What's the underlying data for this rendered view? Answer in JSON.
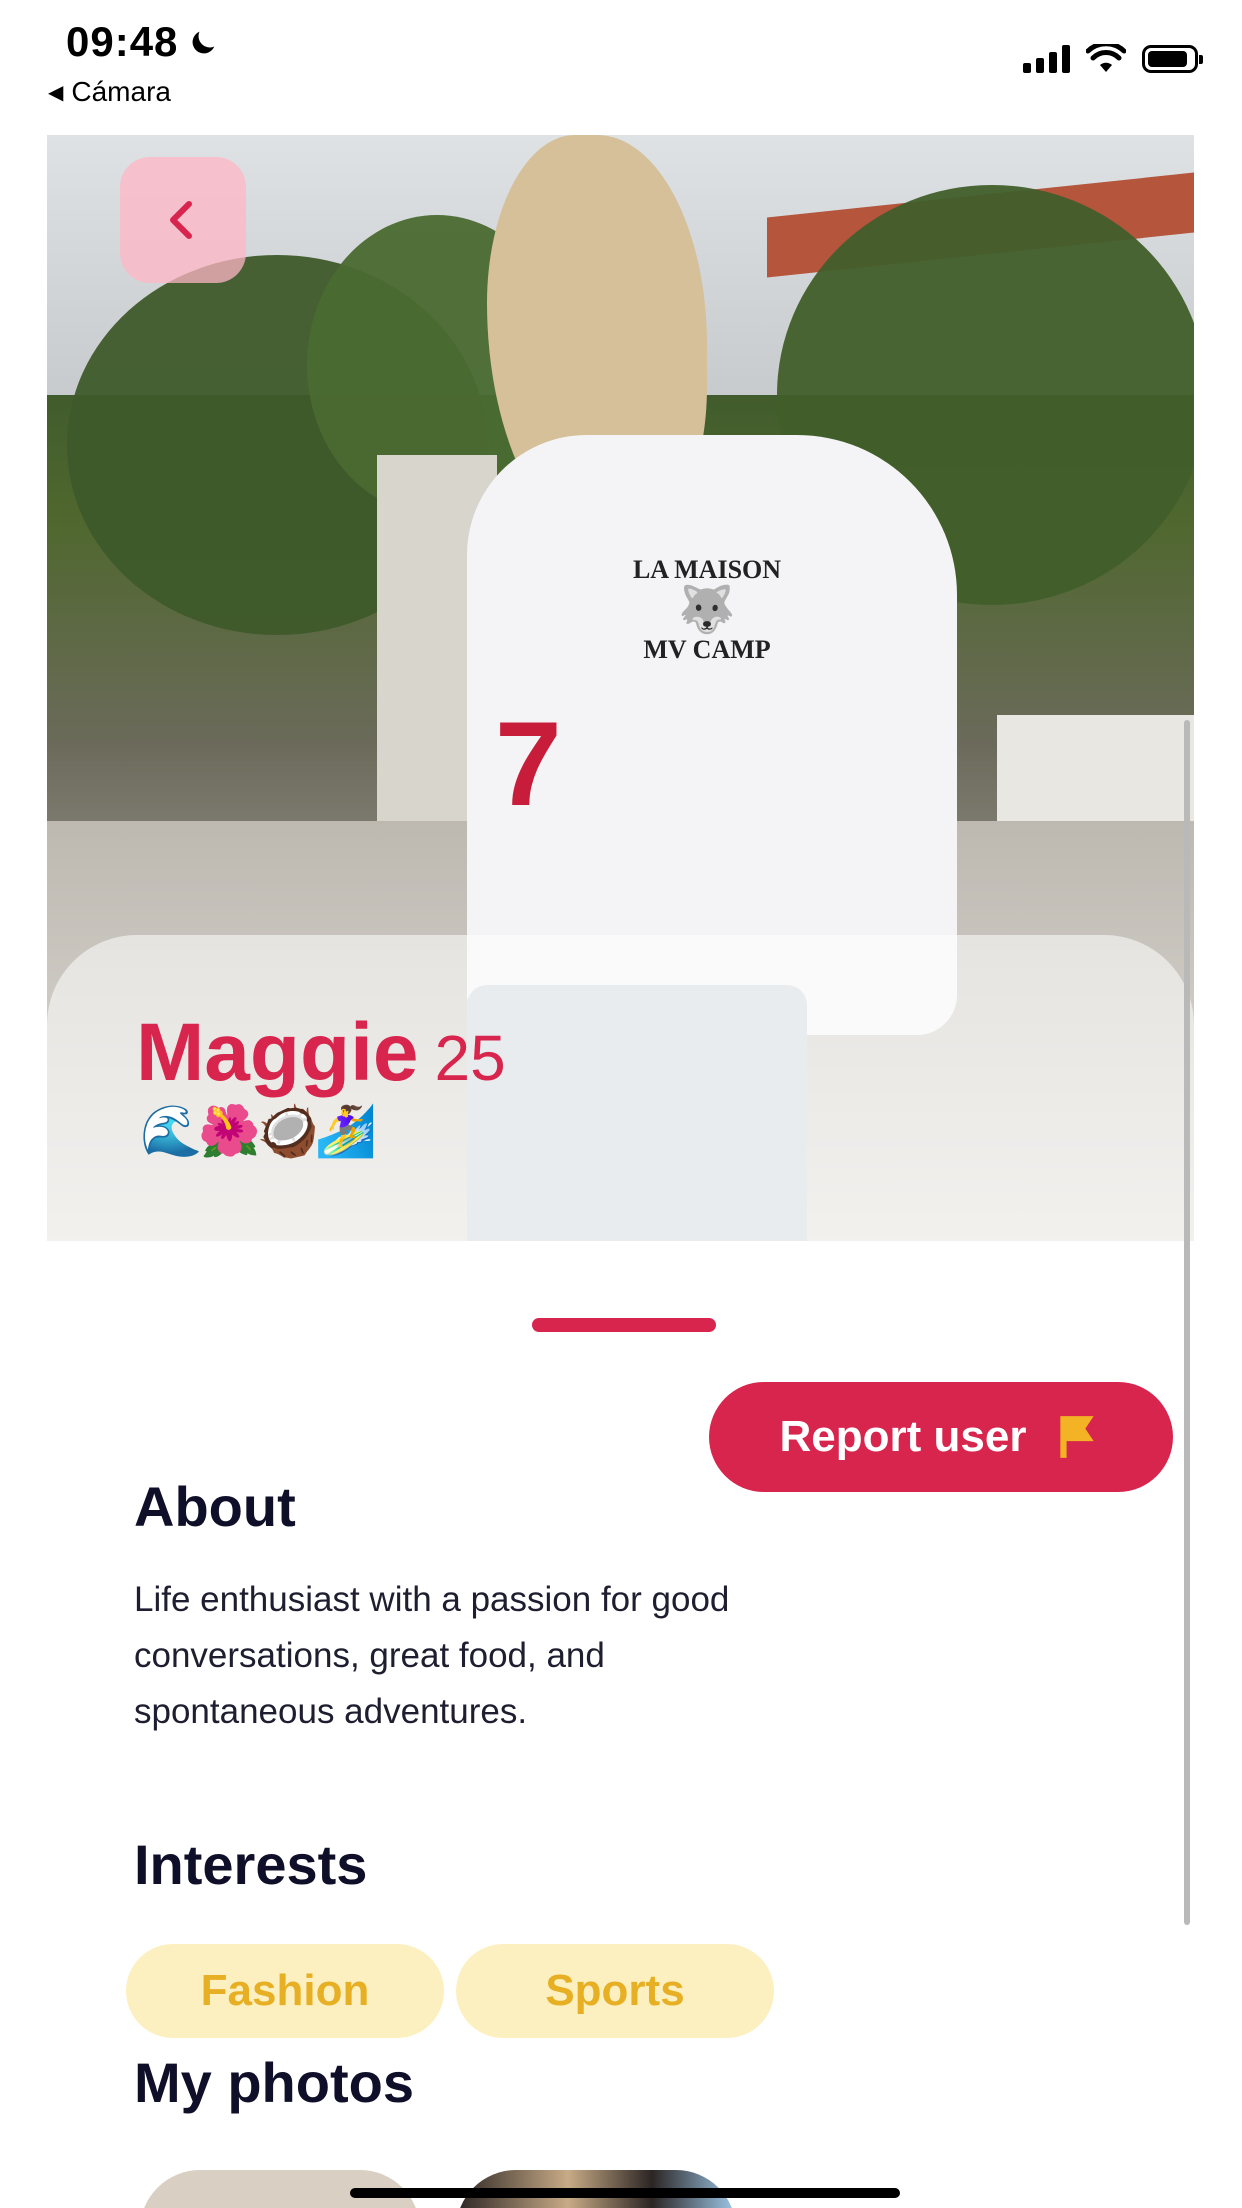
{
  "status_bar": {
    "time": "09:48",
    "back_app_label": "Cámara",
    "icons": [
      "moon-icon",
      "signal-icon",
      "wifi-icon",
      "battery-icon"
    ]
  },
  "profile": {
    "name": "Maggie",
    "age": "25",
    "emojis": "🌊🌺🥥🏄‍♀️",
    "photo_shirt_number": "7",
    "photo_shirt_logo_line1": "LA MAISON",
    "photo_shirt_logo_line2": "MV CAMP"
  },
  "actions": {
    "report_label": "Report user"
  },
  "about": {
    "title": "About",
    "text": "Life enthusiast with a passion for good conversations, great food, and spontaneous adventures."
  },
  "interests": {
    "title": "Interests",
    "items": [
      "Fashion",
      "Sports"
    ]
  },
  "photos": {
    "title": "My photos"
  },
  "colors": {
    "accent": "#d8254d",
    "chip_bg": "#fdf0c0",
    "chip_text": "#e7b024",
    "flag": "#f4b324"
  }
}
